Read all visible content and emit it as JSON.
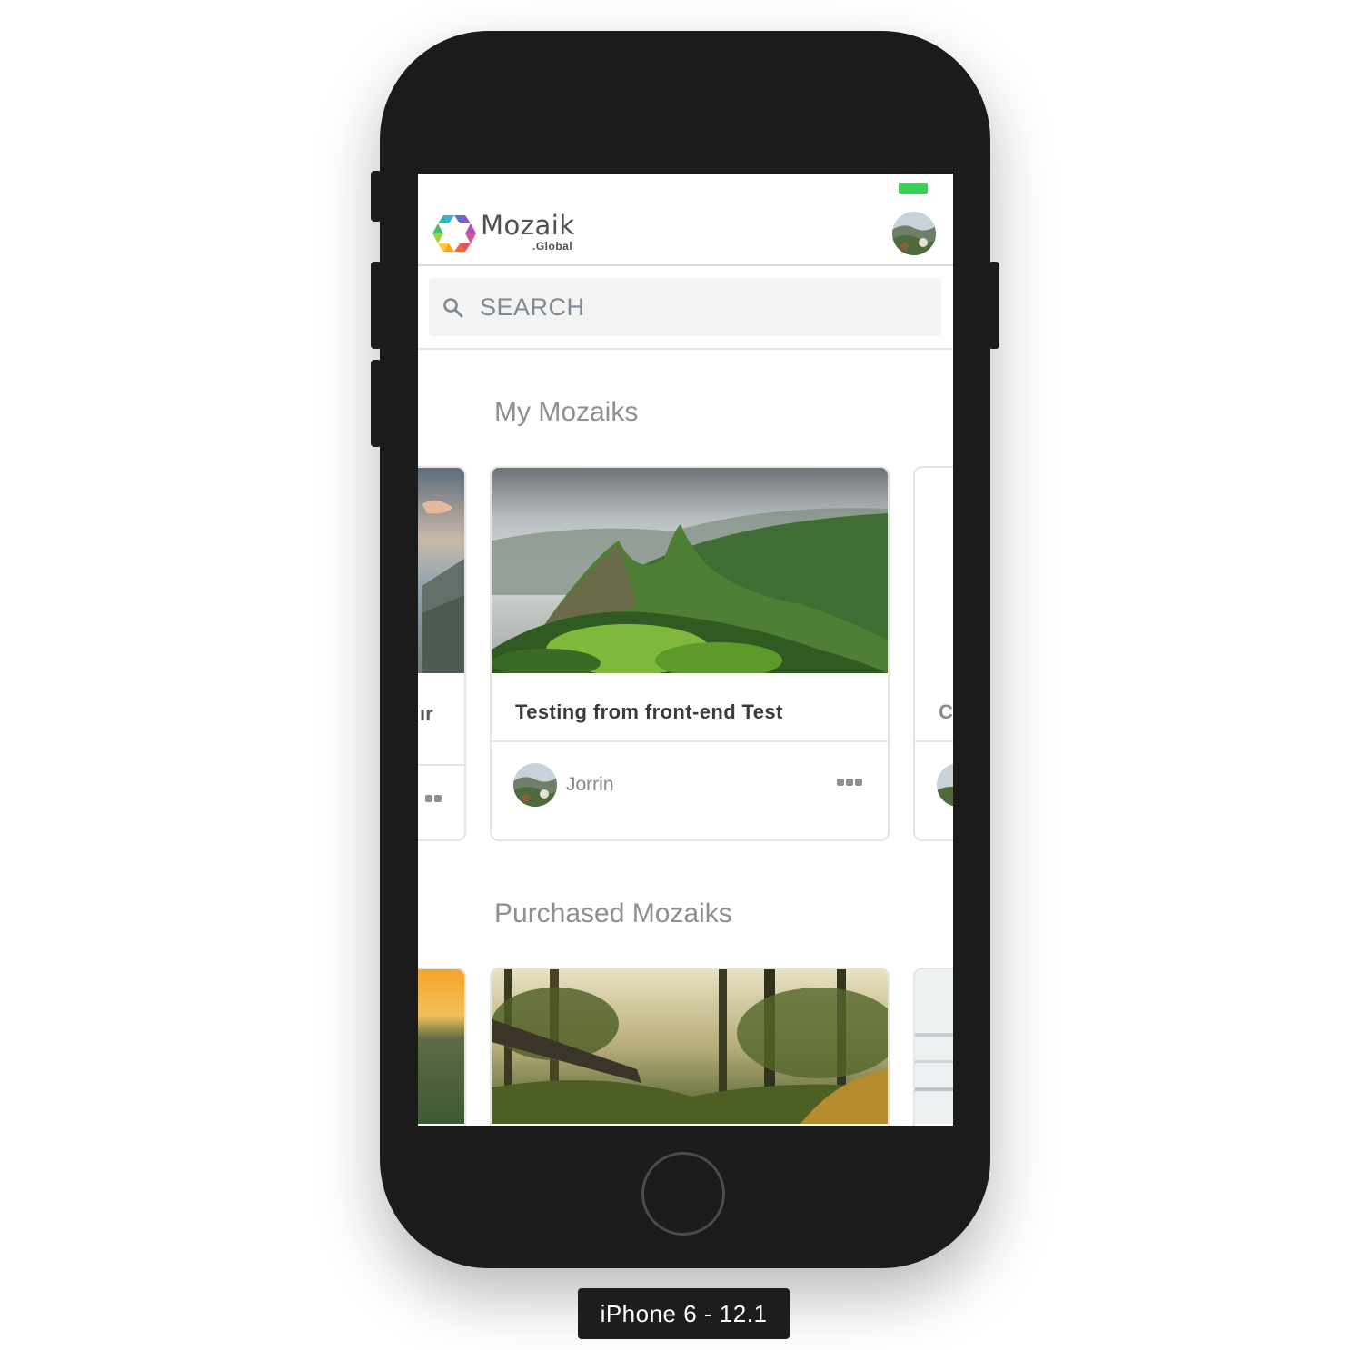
{
  "brand": {
    "name": "Mozaik",
    "suffix": ".Global"
  },
  "search": {
    "placeholder": "SEARCH"
  },
  "sections": {
    "my_mozaiks": {
      "title": "My Mozaiks",
      "left_card_text": "ır",
      "right_card_text": "C",
      "card": {
        "title": "Testing from front-end Test",
        "owner": "Jorrin"
      }
    },
    "purchased_mozaiks": {
      "title": "Purchased Mozaiks"
    }
  },
  "device": {
    "label": "iPhone 6 - 12.1"
  },
  "colors": {
    "battery": "#3ccc5a",
    "frame": "#1b1b1c",
    "muted_text": "#8f8f8f"
  },
  "icons": {
    "logo": "hexagon-logo-icon",
    "search": "search-icon",
    "more": "more-horizontal-icon",
    "battery": "battery-icon"
  }
}
